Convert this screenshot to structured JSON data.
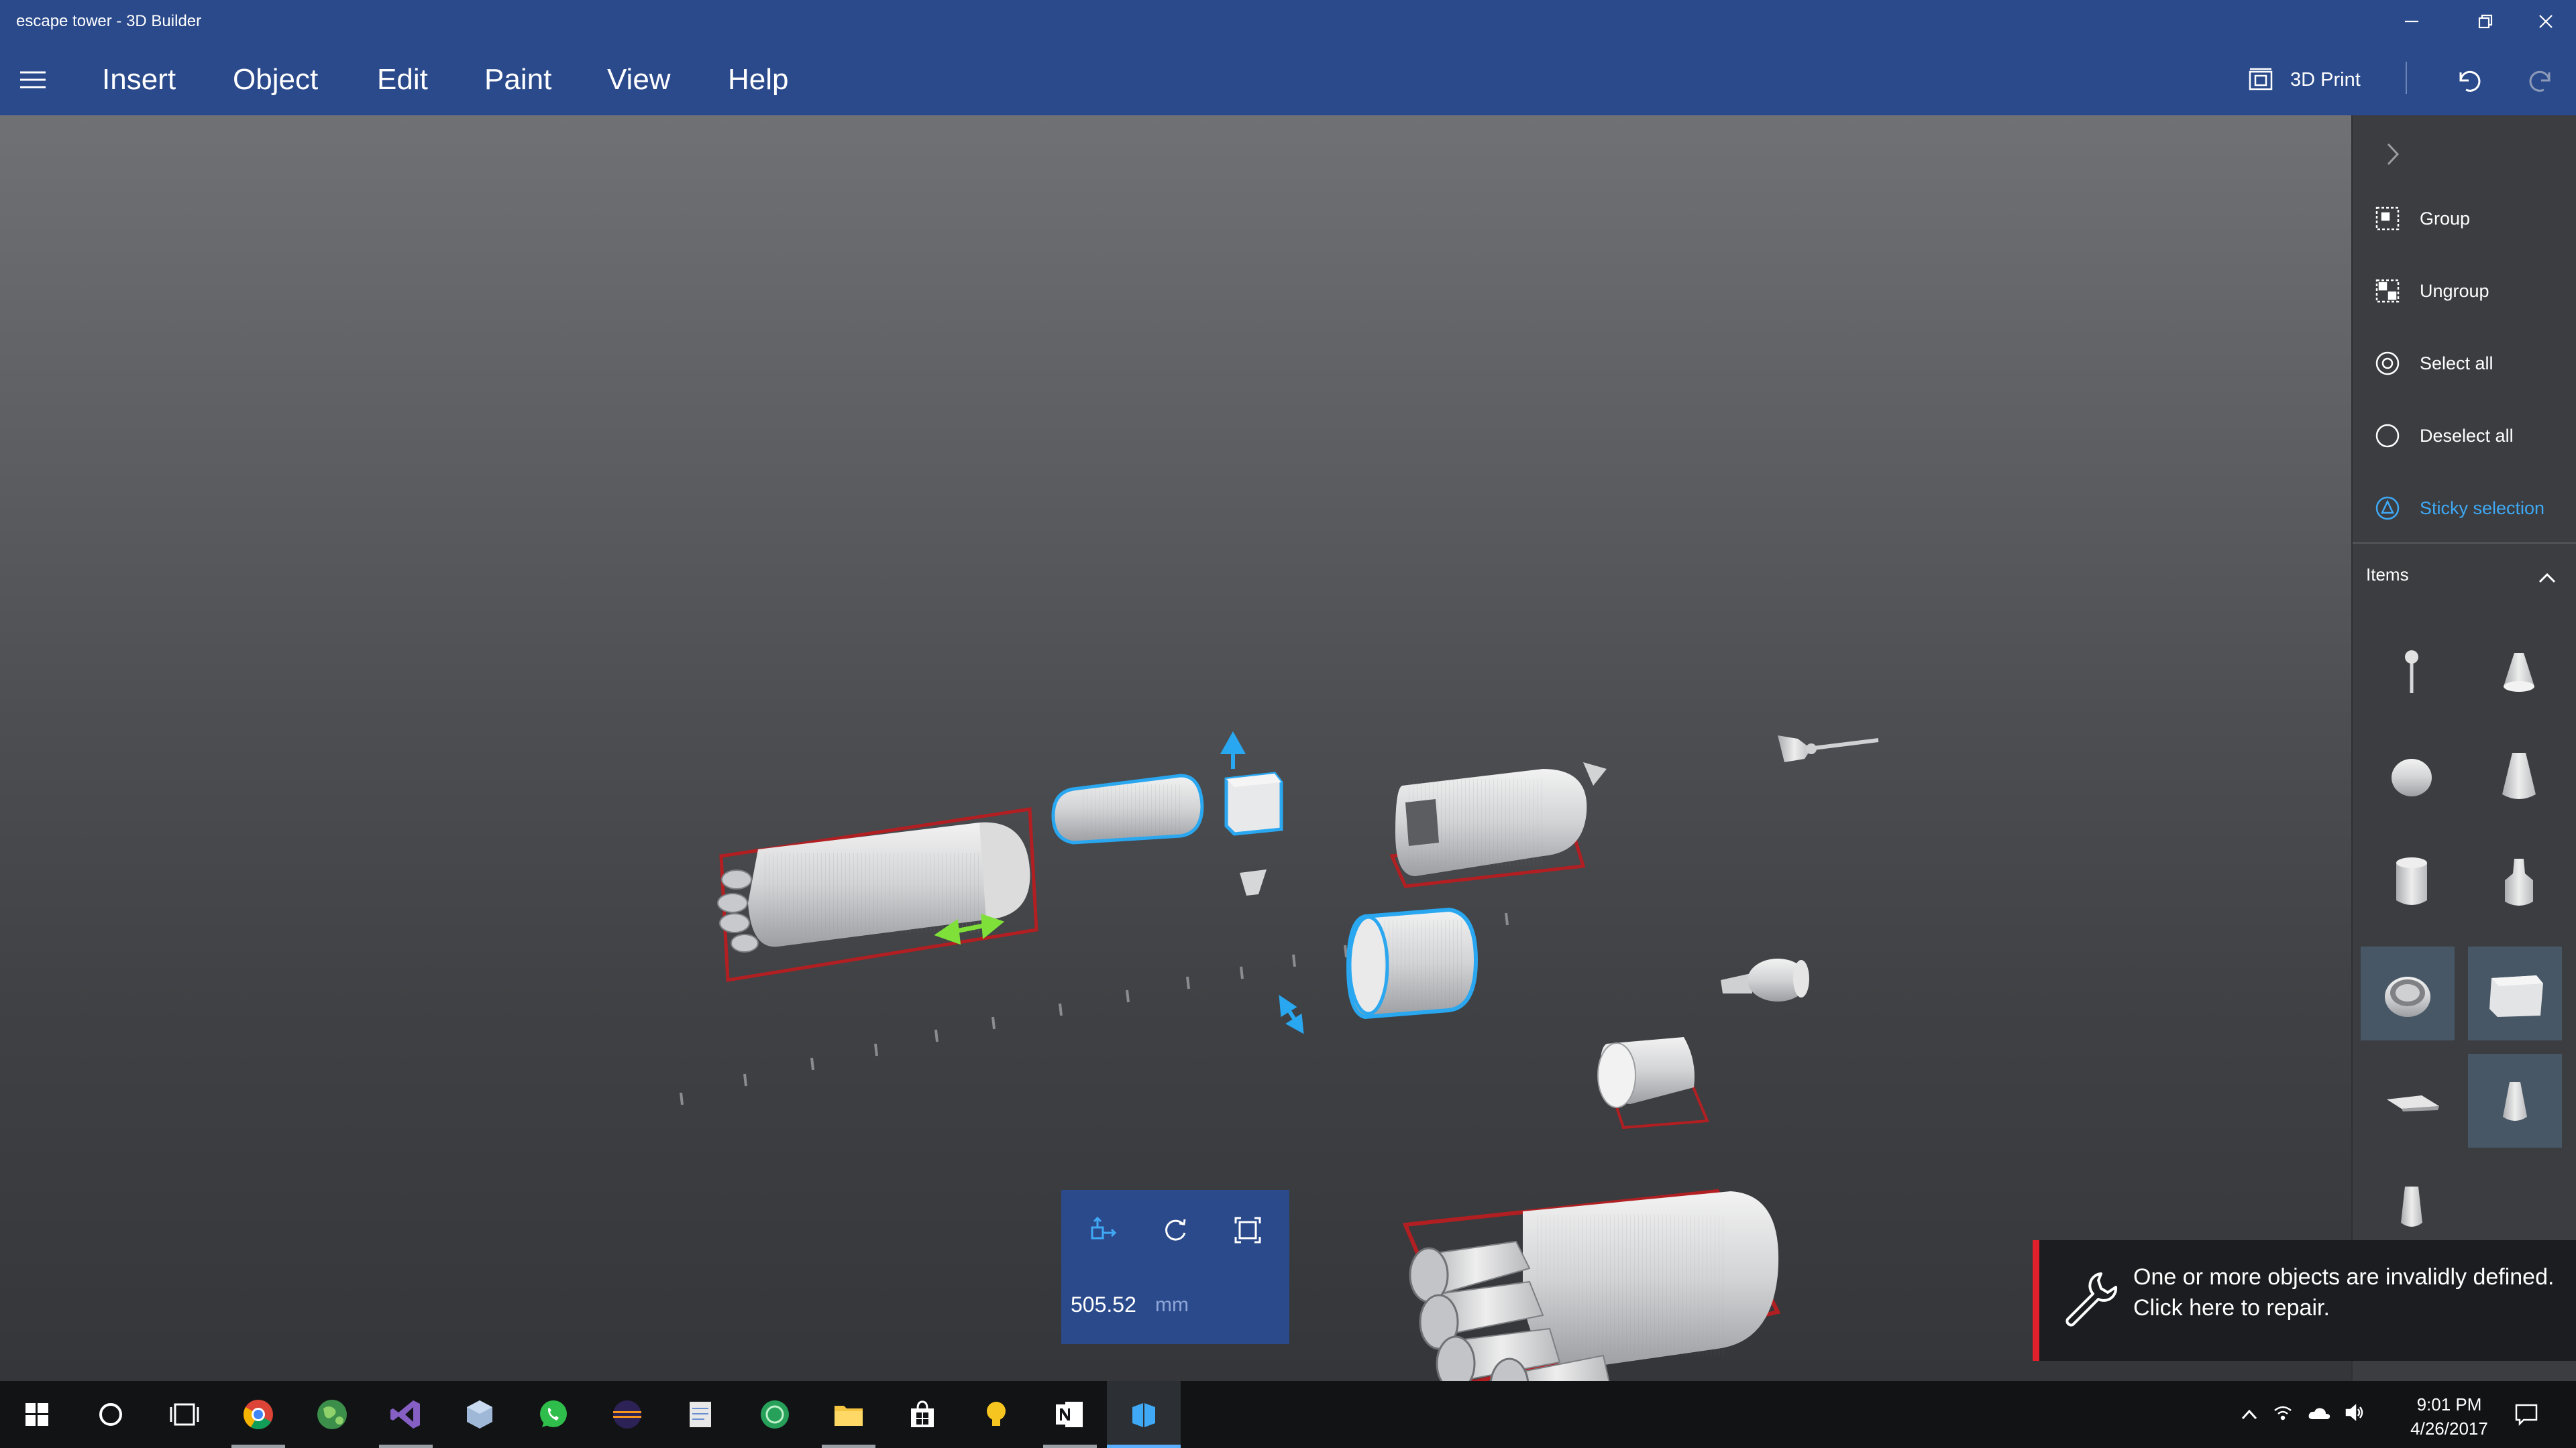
{
  "window": {
    "title": "escape tower - 3D Builder",
    "controls": [
      "minimize-icon",
      "restore-icon",
      "close-icon"
    ]
  },
  "menu": {
    "items": [
      "Insert",
      "Object",
      "Edit",
      "Paint",
      "View",
      "Help"
    ],
    "print_label": "3D Print",
    "icons": [
      "hamburger-icon",
      "printer-icon",
      "undo-icon",
      "redo-icon"
    ]
  },
  "panel": {
    "actions": [
      {
        "label": "Group",
        "icon": "group-icon"
      },
      {
        "label": "Ungroup",
        "icon": "ungroup-icon"
      },
      {
        "label": "Select all",
        "icon": "select-all-icon"
      },
      {
        "label": "Deselect all",
        "icon": "deselect-all-icon"
      },
      {
        "label": "Sticky selection",
        "icon": "sticky-selection-icon"
      }
    ],
    "items_label": "Items",
    "thumbnails": [
      {
        "name": "escape-tower-rod",
        "selected": false
      },
      {
        "name": "bell-nozzle",
        "selected": false
      },
      {
        "name": "dome-cap",
        "selected": false
      },
      {
        "name": "capsule-cone",
        "selected": false
      },
      {
        "name": "cylinder-segment",
        "selected": false
      },
      {
        "name": "engine-bell",
        "selected": false
      },
      {
        "name": "ring-stage",
        "selected": true
      },
      {
        "name": "cube-block",
        "selected": true
      },
      {
        "name": "fin-plate",
        "selected": false
      },
      {
        "name": "small-capsule",
        "selected": true
      },
      {
        "name": "thruster",
        "selected": false
      }
    ]
  },
  "transform": {
    "value": "505.52",
    "unit": "mm",
    "tools": [
      "move-icon",
      "rotate-icon",
      "scale-icon"
    ]
  },
  "repair": {
    "line1": "One or more objects are invalidly defined.",
    "line2": "Click here to repair."
  },
  "taskbar": {
    "apps": [
      "windows-start-icon",
      "cortana-icon",
      "task-view-icon",
      "chrome-icon",
      "earth-icon",
      "visual-studio-icon",
      "virtualbox-icon",
      "whatsapp-icon",
      "eclipse-icon",
      "notepad-icon",
      "green-globe-icon",
      "file-explorer-icon",
      "store-icon",
      "lightbulb-icon",
      "onenote-icon",
      "3d-builder-icon"
    ],
    "time": "9:01 PM",
    "date": "4/26/2017"
  },
  "colors": {
    "chrome_blue": "#2b4a8b",
    "accent_blue": "#3fa9f5",
    "selection_outline": "#29a7f0",
    "repair_red": "#e0202a",
    "move_arrow_green": "#7fe03a"
  }
}
